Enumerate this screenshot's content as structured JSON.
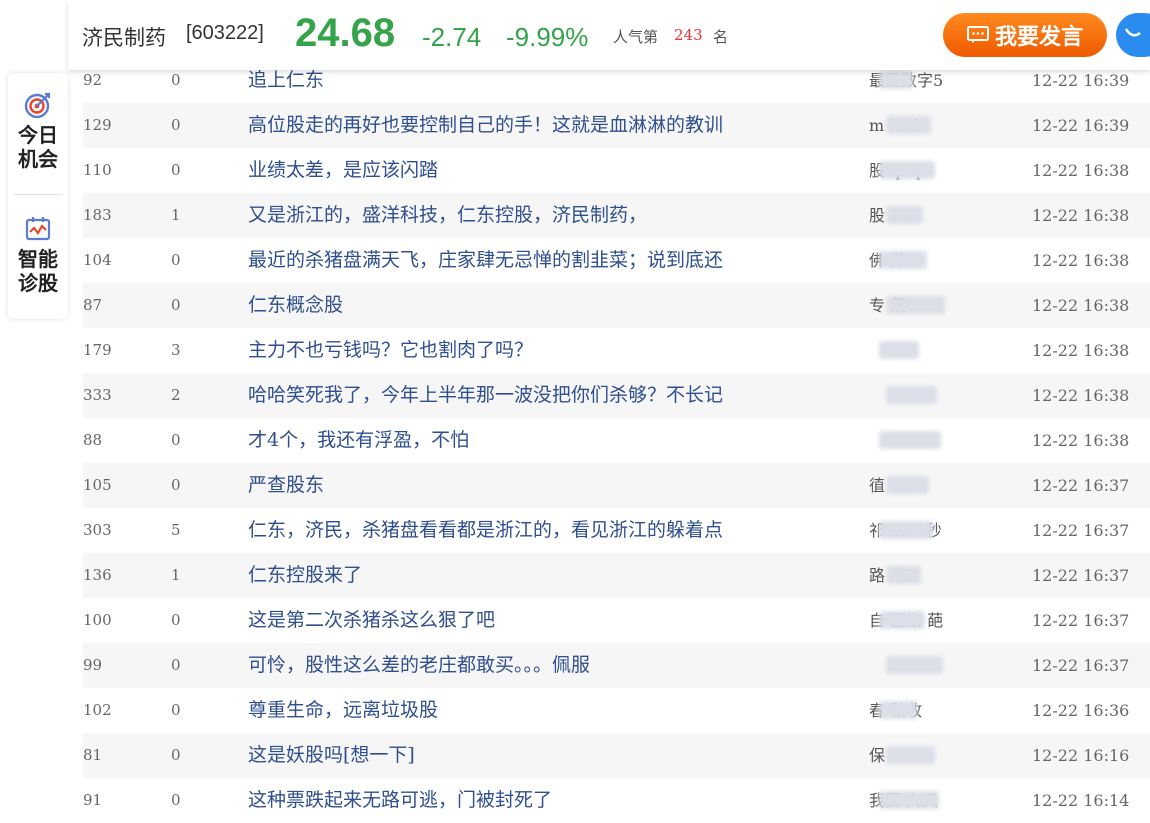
{
  "header": {
    "stock_name": "济民制药",
    "stock_code": "[603222]",
    "price": "24.68",
    "change": "-2.74",
    "change_pct": "-9.99%",
    "popularity_label": "人气第",
    "popularity_rank": "243",
    "popularity_unit": "名",
    "post_button": "我要发言",
    "price_color": "#34a34a",
    "button_color": "#f47312"
  },
  "sidebar": {
    "items": [
      {
        "label": "今日机会",
        "icon": "target-icon"
      },
      {
        "label": "智能诊股",
        "icon": "chart-calendar-icon"
      }
    ]
  },
  "posts": [
    {
      "reads": "92",
      "replies": "0",
      "title": "追上仁东",
      "author": "最爱数字5",
      "time": "12-22 16:39"
    },
    {
      "reads": "129",
      "replies": "0",
      "title": "高位股走的再好也要控制自己的手！这就是血淋淋的教训",
      "author": "m laob",
      "time": "12-22 16:39"
    },
    {
      "reads": "110",
      "replies": "0",
      "title": "业绩太差，是应该闪踏",
      "author": "股 ql q",
      "time": "12-22 16:38"
    },
    {
      "reads": "183",
      "replies": "1",
      "title": "又是浙江的，盛洋科技，仁东控股，济民制药，",
      "author": "股 3v",
      "time": "12-22 16:38"
    },
    {
      "reads": "104",
      "replies": "0",
      "title": "最近的杀猪盘满天飞，庄家肆无忌惮的割韭菜；说到底还",
      "author": "佛 斧",
      "time": "12-22 16:38"
    },
    {
      "reads": "87",
      "replies": "0",
      "title": "仁东概念股",
      "author": "专 菜",
      "time": "12-22 16:38"
    },
    {
      "reads": "179",
      "replies": "3",
      "title": "主力不也亏钱吗？它也割肉了吗？",
      "author": "",
      "time": "12-22 16:38"
    },
    {
      "reads": "333",
      "replies": "2",
      "title": "哈哈笑死我了，今年上半年那一波没把你们杀够？不长记",
      "author": "",
      "time": "12-22 16:38"
    },
    {
      "reads": "88",
      "replies": "0",
      "title": "才4个，我还有浮盈，不怕",
      "author": "",
      "time": "12-22 16:38"
    },
    {
      "reads": "105",
      "replies": "0",
      "title": "严查股东",
      "author": "徝 52",
      "time": "12-22 16:37"
    },
    {
      "reads": "303",
      "replies": "5",
      "title": "仁东，济民，杀猪盘看看都是浙江的，看见浙江的躲着点",
      "author": "祁 29 0秒",
      "time": "12-22 16:37"
    },
    {
      "reads": "136",
      "replies": "1",
      "title": "仁东控股来了",
      "author": "路 来2",
      "time": "12-22 16:37"
    },
    {
      "reads": "100",
      "replies": "0",
      "title": "这是第二次杀猪杀这么狠了吧",
      "author": "自 区出 葩",
      "time": "12-22 16:37"
    },
    {
      "reads": "99",
      "replies": "0",
      "title": "可怜，股性这么差的老庄都敢买。。。佩服",
      "author": "",
      "time": "12-22 16:37"
    },
    {
      "reads": "102",
      "replies": "0",
      "title": "尊重生命，远离垃圾股",
      "author": "春 秋收",
      "time": "12-22 16:36"
    },
    {
      "reads": "81",
      "replies": "0",
      "title": "这是妖股吗[想一下]",
      "author": "保",
      "time": "12-22 16:16"
    },
    {
      "reads": "91",
      "replies": "0",
      "title": "这种票跌起来无路可逃，门被封死了",
      "author": "我要 九天",
      "time": "12-22 16:14"
    }
  ]
}
